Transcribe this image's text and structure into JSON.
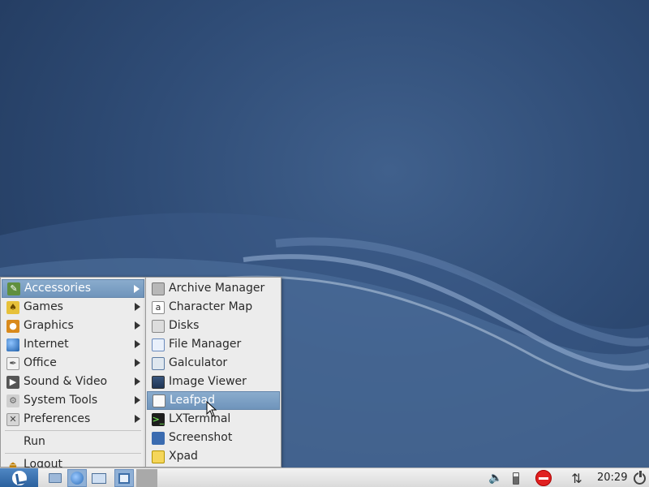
{
  "main_menu": {
    "items": [
      {
        "label": "Accessories",
        "icon": "accessories-icon",
        "submenu": true,
        "highlighted": true
      },
      {
        "label": "Games",
        "icon": "games-icon",
        "submenu": true
      },
      {
        "label": "Graphics",
        "icon": "graphics-icon",
        "submenu": true
      },
      {
        "label": "Internet",
        "icon": "internet-icon",
        "submenu": true
      },
      {
        "label": "Office",
        "icon": "office-icon",
        "submenu": true
      },
      {
        "label": "Sound & Video",
        "icon": "sound-video-icon",
        "submenu": true
      },
      {
        "label": "System Tools",
        "icon": "system-tools-icon",
        "submenu": true
      },
      {
        "label": "Preferences",
        "icon": "preferences-icon",
        "submenu": true
      }
    ],
    "run_label": "Run",
    "logout_label": "Logout"
  },
  "accessories_menu": {
    "items": [
      {
        "label": "Archive Manager",
        "icon": "archive-icon"
      },
      {
        "label": "Character Map",
        "icon": "character-map-icon"
      },
      {
        "label": "Disks",
        "icon": "disks-icon"
      },
      {
        "label": "File Manager",
        "icon": "file-manager-icon"
      },
      {
        "label": "Galculator",
        "icon": "calculator-icon"
      },
      {
        "label": "Image Viewer",
        "icon": "image-viewer-icon"
      },
      {
        "label": "Leafpad",
        "icon": "leafpad-icon",
        "highlighted": true
      },
      {
        "label": "LXTerminal",
        "icon": "terminal-icon"
      },
      {
        "label": "Screenshot",
        "icon": "screenshot-icon"
      },
      {
        "label": "Xpad",
        "icon": "xpad-icon"
      }
    ]
  },
  "taskbar": {
    "clock": "20:29"
  },
  "colors": {
    "highlight": "#7a9ec4",
    "menu_bg": "#ececec",
    "desktop": "#2f4c76",
    "taskbar": "#e6e6e6"
  }
}
